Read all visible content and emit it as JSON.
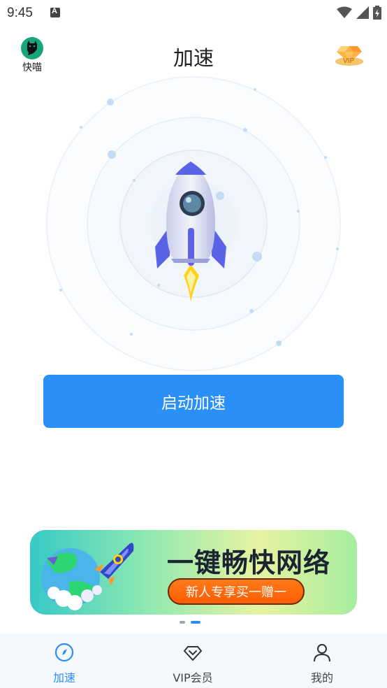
{
  "status_bar": {
    "time": "9:45"
  },
  "header": {
    "logo_label": "快喵",
    "title": "加速",
    "vip_text": "VIP"
  },
  "main": {
    "start_button_label": "启动加速"
  },
  "banner": {
    "title": "一键畅快网络",
    "cta": "新人专享买一赠一"
  },
  "tabs": [
    {
      "label": "加速",
      "icon": "compass-icon",
      "active": true
    },
    {
      "label": "VIP会员",
      "icon": "diamond-icon",
      "active": false
    },
    {
      "label": "我的",
      "icon": "user-icon",
      "active": false
    }
  ],
  "colors": {
    "accent": "#2b8ff8",
    "logo_green": "#16a67a",
    "cta_orange": "#ff6a0f"
  }
}
